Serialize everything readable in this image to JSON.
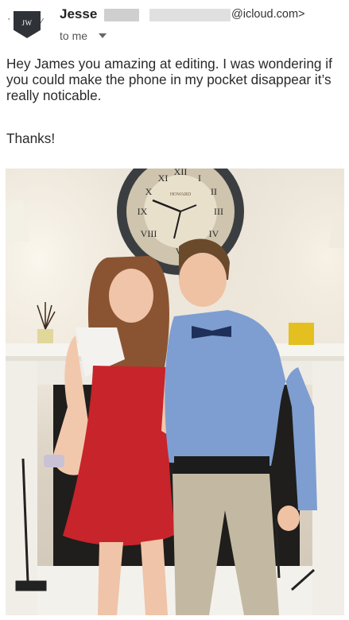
{
  "sender": {
    "avatar_initials": "JW",
    "name": "Jesse",
    "email_domain": "@icloud.com>",
    "recipient": "to me"
  },
  "message": {
    "body": "Hey James you amazing at editing. I was wondering if you could make the phone in my pocket disappear it’s really noticable.",
    "signoff": "Thanks!"
  },
  "photo": {
    "clock_brand": "HOWARD"
  },
  "icons": [
    "avatar-badge-icon",
    "chevron-down-icon"
  ]
}
